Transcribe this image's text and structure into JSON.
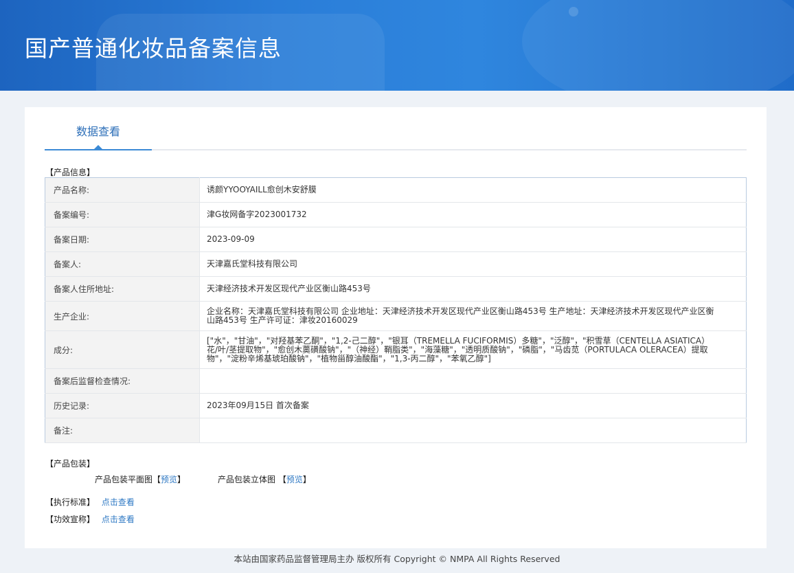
{
  "header": {
    "title": "国产普通化妆品备案信息"
  },
  "tabs": [
    {
      "label": "数据查看"
    }
  ],
  "product_info": {
    "section_title": "【产品信息】",
    "rows": [
      {
        "label": "产品名称:",
        "value": "诱颜YYOOYAILL愈创木安舒膜"
      },
      {
        "label": "备案编号:",
        "value": "津G妆网备字2023001732"
      },
      {
        "label": "备案日期:",
        "value": "2023-09-09"
      },
      {
        "label": "备案人:",
        "value": "天津嘉氏堂科技有限公司"
      },
      {
        "label": "备案人住所地址:",
        "value": "天津经济技术开发区现代产业区衡山路453号"
      },
      {
        "label": "生产企业:",
        "value": "企业名称：天津嘉氏堂科技有限公司 企业地址：天津经济技术开发区现代产业区衡山路453号 生产地址：天津经济技术开发区现代产业区衡山路453号 生产许可证：津妆20160029"
      },
      {
        "label": "成分:",
        "value": "[\"水\"，\"甘油\"，\"对羟基苯乙酮\"，\"1,2-己二醇\"，\"银耳（TREMELLA FUCIFORMIS）多糖\"，\"泛醇\"，\"积雪草（CENTELLA ASIATICA）花/叶/茎提取物\"，\"愈创木薁磺酸钠\"，\"（神经）鞘脂类\"，\"海藻糖\"，\"透明质酸钠\"，\"磷脂\"，\"马齿苋（PORTULACA OLERACEA）提取物\"，\"淀粉辛烯基琥珀酸钠\"，\"植物甾醇油酸酯\"，\"1,3-丙二醇\"，\"苯氧乙醇\"]"
      },
      {
        "label": "备案后监督检查情况:",
        "value": ""
      },
      {
        "label": "历史记录:",
        "value": "2023年09月15日 首次备案"
      },
      {
        "label": "备注:",
        "value": ""
      }
    ]
  },
  "packaging": {
    "section_title": "【产品包装】",
    "flat_label": "产品包装平面图",
    "stereo_label": "产品包装立体图",
    "bracket_open": "【",
    "bracket_close": "】",
    "preview_label": "预览"
  },
  "standard": {
    "title": "【执行标准】",
    "link": "点击查看"
  },
  "efficacy": {
    "title": "【功效宣称】",
    "link": "点击查看"
  },
  "footer": {
    "text": "本站由国家药品监督管理局主办 版权所有 Copyright © NMPA All Rights Reserved"
  }
}
